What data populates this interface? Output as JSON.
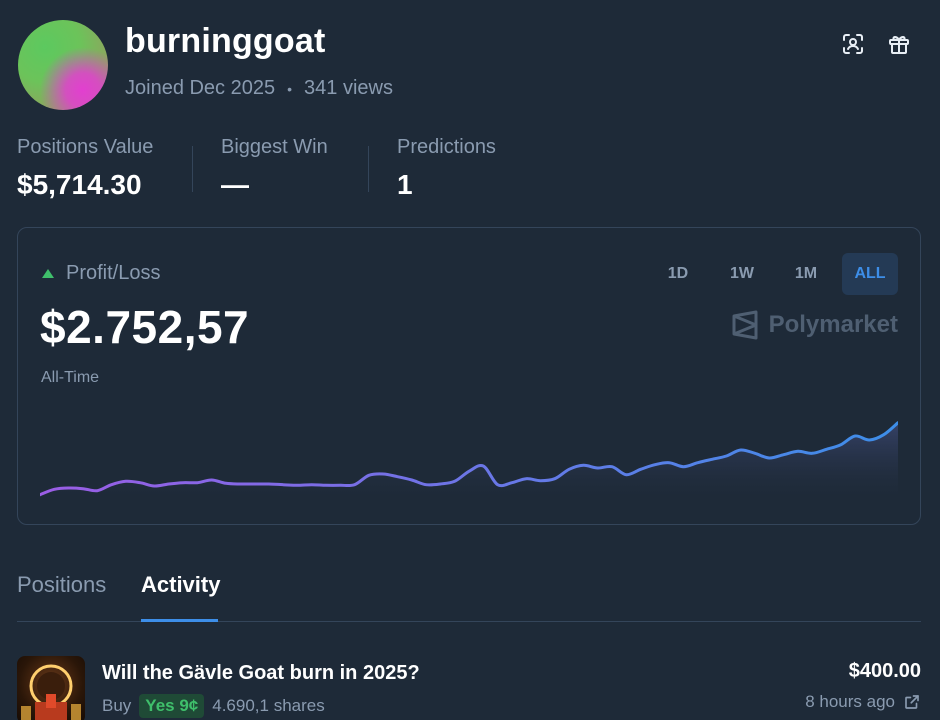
{
  "profile": {
    "username": "burninggoat",
    "joined": "Joined Dec 2025",
    "separator": "•",
    "views": "341 views",
    "icons": [
      "scan-icon",
      "gift-icon"
    ]
  },
  "stats": [
    {
      "label": "Positions Value",
      "value": "$5,714.30"
    },
    {
      "label": "Biggest Win",
      "value": "—"
    },
    {
      "label": "Predictions",
      "value": "1"
    }
  ],
  "pnl": {
    "label": "Profit/Loss",
    "value": "$2.752,57",
    "period_label": "All-Time",
    "ranges": [
      "1D",
      "1W",
      "1M",
      "ALL"
    ],
    "active_range": "ALL",
    "brand": "Polymarket",
    "trend": "up",
    "colors": {
      "up": "#3fbf6b",
      "line_start": "#9b5de5",
      "line_end": "#3d8ee8"
    }
  },
  "chart_data": {
    "type": "area",
    "title": "",
    "xlabel": "",
    "ylabel": "",
    "values": [
      0,
      8,
      10,
      9,
      6,
      15,
      20,
      18,
      13,
      16,
      18,
      18,
      22,
      17,
      16,
      16,
      16,
      15,
      14,
      15,
      14,
      14,
      15,
      29,
      31,
      27,
      22,
      15,
      16,
      20,
      35,
      43,
      15,
      18,
      24,
      21,
      24,
      38,
      44,
      40,
      42,
      30,
      38,
      45,
      48,
      42,
      48,
      53,
      58,
      67,
      62,
      55,
      60,
      65,
      62,
      68,
      75,
      88,
      82,
      90,
      108
    ],
    "ylim": [
      -5,
      130
    ],
    "grid": false,
    "legend": "none"
  },
  "tabs": [
    {
      "label": "Positions",
      "active": false
    },
    {
      "label": "Activity",
      "active": true
    }
  ],
  "activity": [
    {
      "title": "Will the Gävle Goat burn in 2025?",
      "side": "Buy",
      "outcome": "Yes 9¢",
      "shares": "4.690,1 shares",
      "amount": "$400.00",
      "time": "8 hours ago"
    }
  ]
}
